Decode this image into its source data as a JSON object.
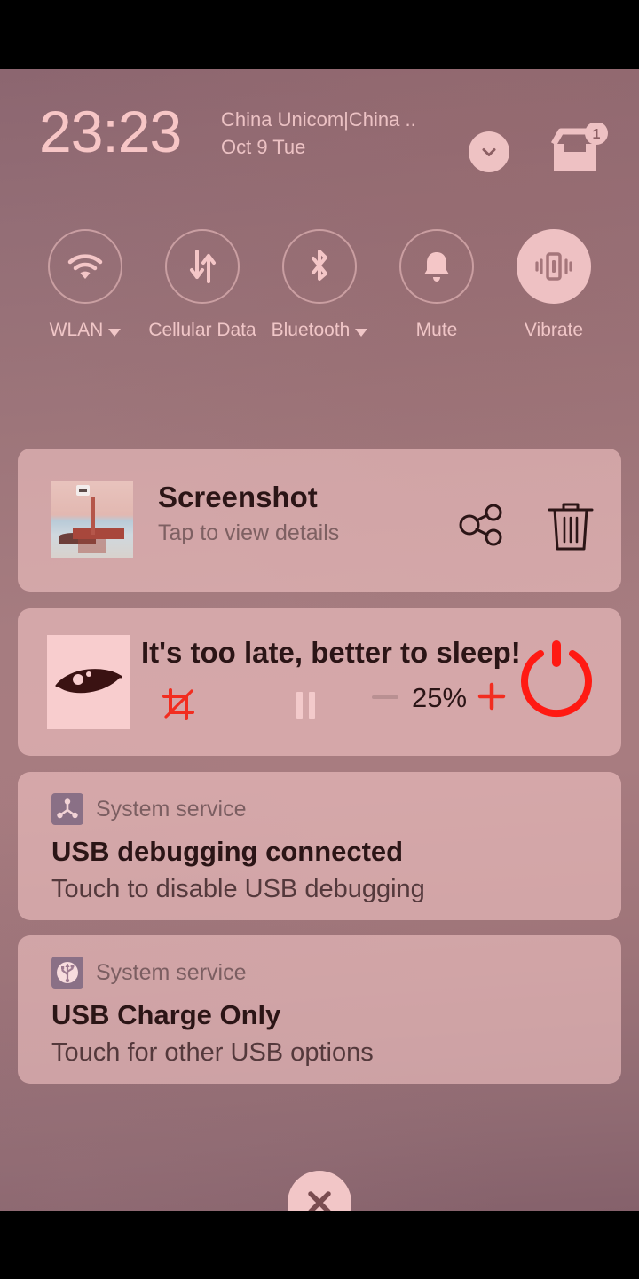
{
  "screen": {
    "time": "23:23",
    "carrier": "China Unicom|China ..",
    "date": "Oct 9 Tue",
    "notification_badge_count": "1"
  },
  "colors": {
    "accent_red": "#ff1a13",
    "panel_pink": "#f4c4c4",
    "text_dark": "#2b1516",
    "text_muted": "#7e6062",
    "header_pink": "#f7c6c6",
    "system_badge_purple": "#8a7086"
  },
  "quick_settings": {
    "tiles": [
      {
        "label": "WLAN",
        "icon": "wifi-icon",
        "has_caret": true,
        "active": false
      },
      {
        "label": "Cellular Data",
        "icon": "cellular-data-icon",
        "has_caret": false,
        "active": false
      },
      {
        "label": "Bluetooth",
        "icon": "bluetooth-icon",
        "has_caret": true,
        "active": false
      },
      {
        "label": "Mute",
        "icon": "bell-icon",
        "has_caret": false,
        "active": false
      },
      {
        "label": "Vibrate",
        "icon": "vibrate-icon",
        "has_caret": false,
        "active": true
      }
    ]
  },
  "header_icons": {
    "expand_chevron": "chevron-down-icon",
    "notification_tray": "inbox-tray-icon"
  },
  "notifications": [
    {
      "id": "screenshot",
      "title": "Screenshot",
      "subtitle": "Tap to view details",
      "thumbnail": "screenshot-thumbnail",
      "actions": [
        {
          "name": "share-icon",
          "label": "Share"
        },
        {
          "name": "delete-icon",
          "label": "Delete"
        }
      ]
    },
    {
      "id": "eye-care",
      "title": "It's too late, better to sleep!",
      "album_art": "eye-icon",
      "percent": "25%",
      "controls": [
        {
          "name": "crop-disabled-icon",
          "state": "off"
        },
        {
          "name": "pause-icon",
          "state": "disabled"
        },
        {
          "name": "minus-icon",
          "state": "dim"
        },
        {
          "name": "plus-icon",
          "state": "active"
        },
        {
          "name": "power-button-icon",
          "state": "on"
        }
      ]
    },
    {
      "id": "usb-debugging",
      "app": "System service",
      "app_icon": "android-debug-icon",
      "title": "USB debugging connected",
      "subtitle": "Touch to disable USB debugging"
    },
    {
      "id": "usb-charge",
      "app": "System service",
      "app_icon": "usb-icon",
      "title": "USB Charge Only",
      "subtitle": "Touch for other USB options"
    }
  ],
  "footer": {
    "close_label": "Close notifications",
    "close_icon": "close-icon"
  }
}
